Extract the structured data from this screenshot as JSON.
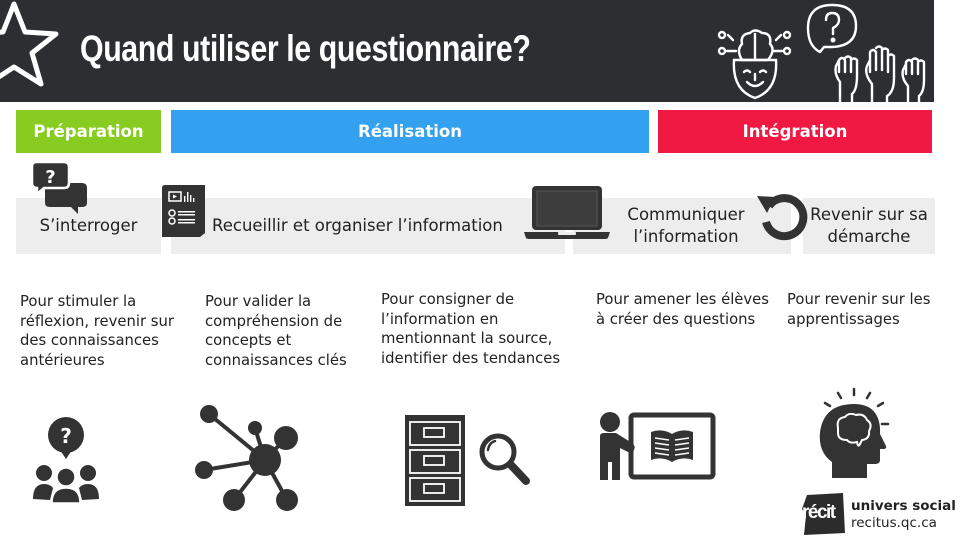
{
  "header": {
    "title": "Quand utiliser le questionnaire?",
    "background": "#2c2e31",
    "decor_icons": [
      "star-outline-icon",
      "open-head-brain-icon",
      "question-speech-bubble-icon",
      "raised-hands-icon"
    ]
  },
  "phases": [
    {
      "label": "Préparation",
      "color": "#88cc22"
    },
    {
      "label": "Réalisation",
      "color": "#33a0f0"
    },
    {
      "label": "Intégration",
      "color": "#ef1944"
    }
  ],
  "steps": [
    {
      "label": "S’interroger",
      "icon": "question-chat-bubbles-icon"
    },
    {
      "label": "Recueillir et organiser l’information",
      "icon": "report-document-icon"
    },
    {
      "label": "Communiquer l’information",
      "icon": "laptop-icon"
    },
    {
      "label": "Revenir sur sa démarche",
      "icon": "circular-arrow-icon"
    }
  ],
  "descriptions": [
    {
      "text": "Pour stimuler la réflexion, revenir sur des connaissances antérieures",
      "icon": "group-question-icon"
    },
    {
      "text": "Pour valider la compréhension de concepts et connaissances clés",
      "icon": "network-nodes-icon"
    },
    {
      "text": "Pour consigner de l’information en mentionnant la source, identifier des tendances",
      "icon": "file-cabinet-search-icon"
    },
    {
      "text": "Pour amener les élèves à créer des questions",
      "icon": "teacher-board-book-icon"
    },
    {
      "text": "Pour revenir sur les apprentissages",
      "icon": "head-brain-idea-icon"
    }
  ],
  "logo": {
    "mark": "récit",
    "name": "univers social",
    "url": "recitus.qc.ca"
  },
  "colors": {
    "icon_dark": "#333333",
    "step_bg": "#ededed"
  }
}
